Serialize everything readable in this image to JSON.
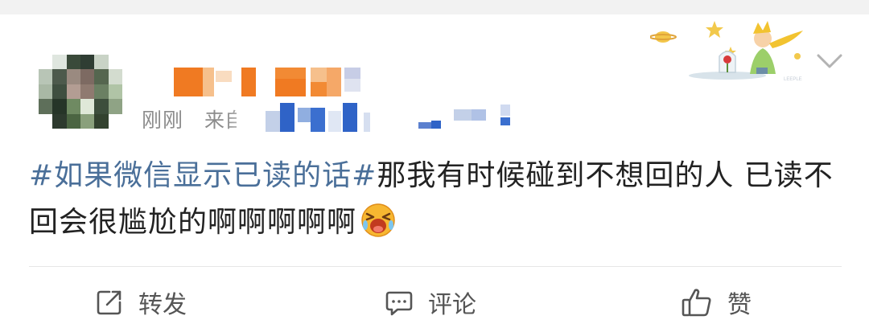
{
  "post": {
    "time": "刚刚",
    "source_prefix": "来自",
    "hashtag": "#如果微信显示已读的话#",
    "body": "那我有时候碰到不想回的人 已读不回会很尴尬的啊啊啊啊啊",
    "emoji": "crying-face-emoji"
  },
  "actions": {
    "repost": "转发",
    "comment": "评论",
    "like": "赞"
  },
  "colors": {
    "hashtag": "#4a6f99",
    "meta": "#8c8c8c",
    "text": "#222222"
  }
}
